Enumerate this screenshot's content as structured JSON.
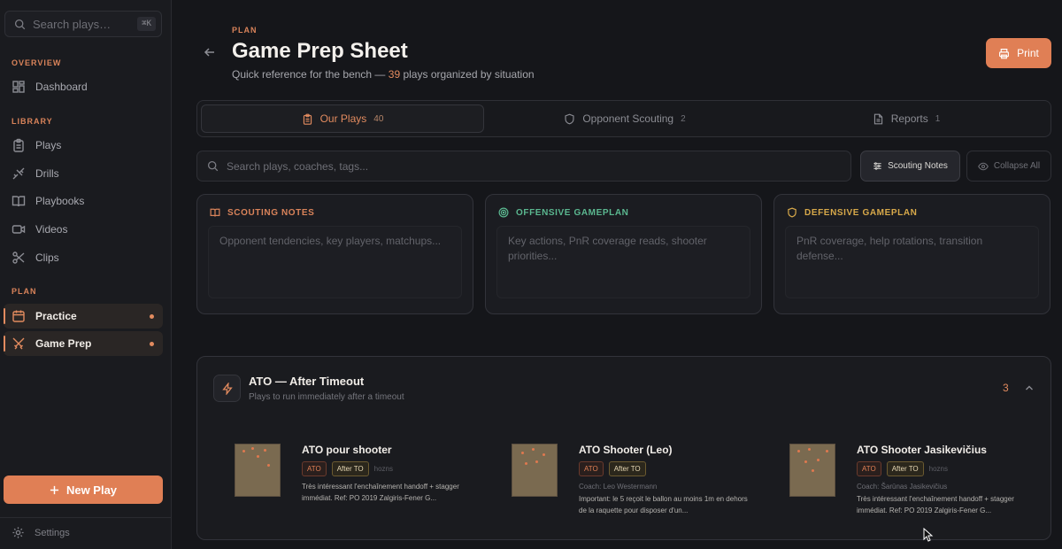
{
  "sidebar": {
    "search_placeholder": "Search plays…",
    "shortcut": "⌘K",
    "sections": {
      "overview": "OVERVIEW",
      "library": "LIBRARY",
      "plan": "PLAN"
    },
    "items": {
      "dashboard": "Dashboard",
      "plays": "Plays",
      "drills": "Drills",
      "playbooks": "Playbooks",
      "videos": "Videos",
      "clips": "Clips",
      "practice": "Practice",
      "game_prep": "Game Prep"
    },
    "new_play": "New Play",
    "settings": "Settings"
  },
  "header": {
    "eyebrow": "PLAN",
    "title": "Game Prep Sheet",
    "subtitle_pre": "Quick reference for the bench —",
    "plays_count": "39",
    "subtitle_post": "plays organized by situation",
    "print": "Print"
  },
  "tabs": [
    {
      "label": "Our Plays",
      "count": "40",
      "icon": "clipboard-icon"
    },
    {
      "label": "Opponent Scouting",
      "count": "2",
      "icon": "shield-icon"
    },
    {
      "label": "Reports",
      "count": "1",
      "icon": "document-icon"
    }
  ],
  "toolbar": {
    "search_placeholder": "Search plays, coaches, tags...",
    "notes_button": "Scouting Notes",
    "collapse_button": "Collapse All"
  },
  "cards": [
    {
      "title": "SCOUTING NOTES",
      "placeholder": "Opponent tendencies, key players, matchups...",
      "color": "#d9835a"
    },
    {
      "title": "OFFENSIVE GAMEPLAN",
      "placeholder": "Key actions, PnR coverage reads, shooter priorities...",
      "color": "#5bb890"
    },
    {
      "title": "DEFENSIVE GAMEPLAN",
      "placeholder": "PnR coverage, help rotations, transition defense...",
      "color": "#d8a94a"
    }
  ],
  "ato": {
    "title": "ATO — After Timeout",
    "subtitle": "Plays to run immediately after a timeout",
    "count": "3",
    "plays": [
      {
        "name": "ATO pour shooter",
        "tag1": "ATO",
        "tag2": "After TO",
        "extra": "hozns",
        "coach": "",
        "desc": "Très intéressant l'enchaînement handoff + stagger immédiat. Ref: PO 2019 Zalgiris-Fener G..."
      },
      {
        "name": "ATO Shooter (Leo)",
        "tag1": "ATO",
        "tag2": "After TO",
        "extra": "",
        "coach": "Coach: Leo Westermann",
        "desc": "Important: le 5 reçoit le ballon au moins 1m en dehors de la raquette pour disposer d'un..."
      },
      {
        "name": "ATO Shooter Jasikevičius",
        "tag1": "ATO",
        "tag2": "After TO",
        "extra": "hozns",
        "coach": "Coach: Šarūnas Jasikevičius",
        "desc": "Très intéressant l'enchaînement handoff + stagger immédiat. Ref: PO 2019 Zalgiris-Fener G..."
      }
    ]
  },
  "colors": {
    "accent": "#e07f55",
    "bg": "#15161a",
    "sidebar": "#1a1b1f"
  }
}
